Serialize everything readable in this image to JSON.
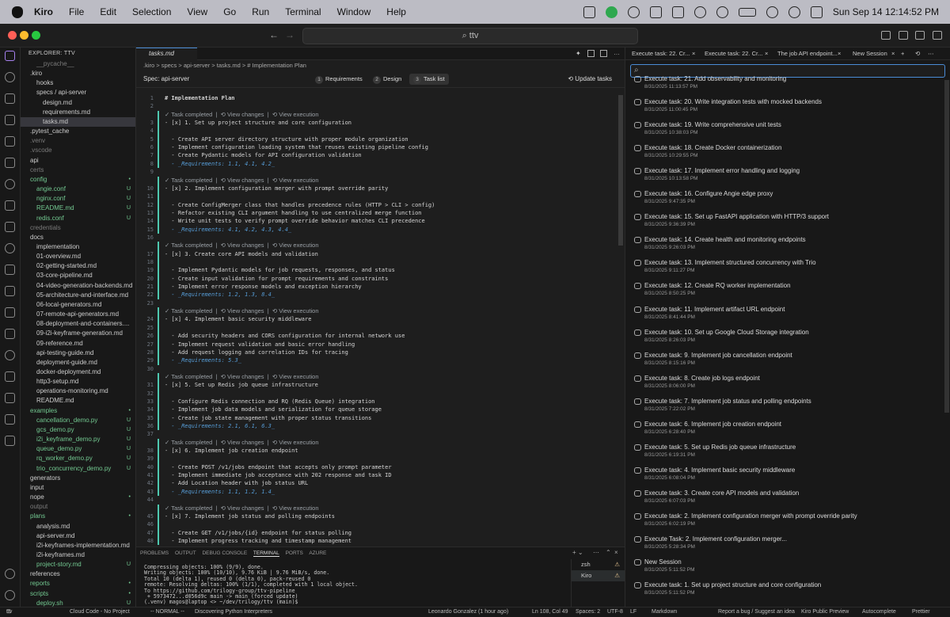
{
  "menubar": {
    "app": "Kiro",
    "items": [
      "File",
      "Edit",
      "Selection",
      "View",
      "Go",
      "Run",
      "Terminal",
      "Window",
      "Help"
    ],
    "clock": "Sun Sep 14  12:14:52 PM"
  },
  "titlebar": {
    "search": "ttv"
  },
  "explorer": {
    "title": "EXPLORER: TTV",
    "rows": [
      {
        "label": "__pycache__",
        "indent": 1,
        "cls": "dim",
        "status": ""
      },
      {
        "label": ".kiro",
        "indent": 0,
        "cls": "",
        "status": ""
      },
      {
        "label": "hooks",
        "indent": 1,
        "cls": "",
        "status": ""
      },
      {
        "label": "specs / api-server",
        "indent": 1,
        "cls": "",
        "status": ""
      },
      {
        "label": "design.md",
        "indent": 2,
        "cls": "",
        "status": ""
      },
      {
        "label": "requirements.md",
        "indent": 2,
        "cls": "",
        "status": ""
      },
      {
        "label": "tasks.md",
        "indent": 2,
        "cls": "sel",
        "status": ""
      },
      {
        "label": ".pytest_cache",
        "indent": 0,
        "cls": "",
        "status": ""
      },
      {
        "label": ".venv",
        "indent": 0,
        "cls": "dim",
        "status": ""
      },
      {
        "label": ".vscode",
        "indent": 0,
        "cls": "dim",
        "status": ""
      },
      {
        "label": "api",
        "indent": 0,
        "cls": "",
        "status": ""
      },
      {
        "label": "certs",
        "indent": 0,
        "cls": "dim",
        "status": ""
      },
      {
        "label": "config",
        "indent": 0,
        "cls": "unt",
        "status": "•"
      },
      {
        "label": "angie.conf",
        "indent": 1,
        "cls": "unt",
        "status": "U"
      },
      {
        "label": "nginx.conf",
        "indent": 1,
        "cls": "unt",
        "status": "U"
      },
      {
        "label": "README.md",
        "indent": 1,
        "cls": "unt",
        "status": "U"
      },
      {
        "label": "redis.conf",
        "indent": 1,
        "cls": "unt",
        "status": "U"
      },
      {
        "label": "credentials",
        "indent": 0,
        "cls": "dim",
        "status": ""
      },
      {
        "label": "docs",
        "indent": 0,
        "cls": "",
        "status": ""
      },
      {
        "label": "implementation",
        "indent": 1,
        "cls": "",
        "status": ""
      },
      {
        "label": "01-overview.md",
        "indent": 1,
        "cls": "",
        "status": ""
      },
      {
        "label": "02-getting-started.md",
        "indent": 1,
        "cls": "",
        "status": ""
      },
      {
        "label": "03-core-pipeline.md",
        "indent": 1,
        "cls": "",
        "status": ""
      },
      {
        "label": "04-video-generation-backends.md",
        "indent": 1,
        "cls": "",
        "status": ""
      },
      {
        "label": "05-architecture-and-interface.md",
        "indent": 1,
        "cls": "",
        "status": ""
      },
      {
        "label": "06-local-generators.md",
        "indent": 1,
        "cls": "",
        "status": ""
      },
      {
        "label": "07-remote-api-generators.md",
        "indent": 1,
        "cls": "",
        "status": ""
      },
      {
        "label": "08-deployment-and-containers....",
        "indent": 1,
        "cls": "",
        "status": ""
      },
      {
        "label": "09-i2i-keyframe-generation.md",
        "indent": 1,
        "cls": "",
        "status": ""
      },
      {
        "label": "09-reference.md",
        "indent": 1,
        "cls": "",
        "status": ""
      },
      {
        "label": "api-testing-guide.md",
        "indent": 1,
        "cls": "",
        "status": ""
      },
      {
        "label": "deployment-guide.md",
        "indent": 1,
        "cls": "",
        "status": ""
      },
      {
        "label": "docker-deployment.md",
        "indent": 1,
        "cls": "",
        "status": ""
      },
      {
        "label": "http3-setup.md",
        "indent": 1,
        "cls": "",
        "status": ""
      },
      {
        "label": "operations-monitoring.md",
        "indent": 1,
        "cls": "",
        "status": ""
      },
      {
        "label": "README.md",
        "indent": 1,
        "cls": "",
        "status": ""
      },
      {
        "label": "examples",
        "indent": 0,
        "cls": "unt",
        "status": "•"
      },
      {
        "label": "cancellation_demo.py",
        "indent": 1,
        "cls": "unt",
        "status": "U"
      },
      {
        "label": "gcs_demo.py",
        "indent": 1,
        "cls": "unt",
        "status": "U"
      },
      {
        "label": "i2i_keyframe_demo.py",
        "indent": 1,
        "cls": "unt",
        "status": "U"
      },
      {
        "label": "queue_demo.py",
        "indent": 1,
        "cls": "unt",
        "status": "U"
      },
      {
        "label": "rq_worker_demo.py",
        "indent": 1,
        "cls": "unt",
        "status": "U"
      },
      {
        "label": "trio_concurrency_demo.py",
        "indent": 1,
        "cls": "unt",
        "status": "U"
      },
      {
        "label": "generators",
        "indent": 0,
        "cls": "",
        "status": ""
      },
      {
        "label": "input",
        "indent": 0,
        "cls": "",
        "status": ""
      },
      {
        "label": "nope",
        "indent": 0,
        "cls": "",
        "status": "•"
      },
      {
        "label": "output",
        "indent": 0,
        "cls": "dim",
        "status": ""
      },
      {
        "label": "plans",
        "indent": 0,
        "cls": "unt",
        "status": "•"
      },
      {
        "label": "analysis.md",
        "indent": 1,
        "cls": "",
        "status": ""
      },
      {
        "label": "api-server.md",
        "indent": 1,
        "cls": "",
        "status": ""
      },
      {
        "label": "i2i-keyframes-implementation.md",
        "indent": 1,
        "cls": "",
        "status": ""
      },
      {
        "label": "i2i-keyframes.md",
        "indent": 1,
        "cls": "",
        "status": ""
      },
      {
        "label": "project-story.md",
        "indent": 1,
        "cls": "unt",
        "status": "U"
      },
      {
        "label": "references",
        "indent": 0,
        "cls": "",
        "status": ""
      },
      {
        "label": "reports",
        "indent": 0,
        "cls": "unt",
        "status": "•"
      },
      {
        "label": "scripts",
        "indent": 0,
        "cls": "unt",
        "status": "•"
      },
      {
        "label": "deploy.sh",
        "indent": 1,
        "cls": "unt",
        "status": "U"
      }
    ]
  },
  "editor": {
    "tab": "tasks.md",
    "breadcrumb": ".kiro  >  specs  >  api-server  >  tasks.md  >  # Implementation Plan",
    "spec_label": "Spec: api-server",
    "steps": [
      {
        "num": "1",
        "label": "Requirements"
      },
      {
        "num": "2",
        "label": "Design"
      },
      {
        "num": "3",
        "label": "Task list"
      }
    ],
    "update_tasks": "Update tasks",
    "lens_text": "✓ Task completed  |  ⟲ View changes  |  ⟲ View execution",
    "lines": [
      {
        "n": "1",
        "t": "# Implementation Plan",
        "k": "hd"
      },
      {
        "n": "2",
        "t": "",
        "k": "tx"
      },
      {
        "n": "",
        "t": "LENS",
        "k": "lens"
      },
      {
        "n": "3",
        "t": "- [x] 1. Set up project structure and core configuration",
        "k": "tx"
      },
      {
        "n": "4",
        "t": "",
        "k": "tx"
      },
      {
        "n": "5",
        "t": "  - Create API server directory structure with proper module organization",
        "k": "tx"
      },
      {
        "n": "6",
        "t": "  - Implement configuration loading system that reuses existing pipeline config",
        "k": "tx"
      },
      {
        "n": "7",
        "t": "  - Create Pydantic models for API configuration validation",
        "k": "tx"
      },
      {
        "n": "8",
        "t": "  - _Requirements: 1.1, 4.1, 4.2_",
        "k": "em"
      },
      {
        "n": "9",
        "t": "",
        "k": "tx"
      },
      {
        "n": "",
        "t": "LENS",
        "k": "lens"
      },
      {
        "n": "10",
        "t": "- [x] 2. Implement configuration merger with prompt override parity",
        "k": "tx"
      },
      {
        "n": "11",
        "t": "",
        "k": "tx"
      },
      {
        "n": "12",
        "t": "  - Create ConfigMerger class that handles precedence rules (HTTP > CLI > config)",
        "k": "tx"
      },
      {
        "n": "13",
        "t": "  - Refactor existing CLI argument handling to use centralized merge function",
        "k": "tx"
      },
      {
        "n": "14",
        "t": "  - Write unit tests to verify prompt override behavior matches CLI precedence",
        "k": "tx"
      },
      {
        "n": "15",
        "t": "  - _Requirements: 4.1, 4.2, 4.3, 4.4_",
        "k": "em"
      },
      {
        "n": "16",
        "t": "",
        "k": "tx"
      },
      {
        "n": "",
        "t": "LENS",
        "k": "lens"
      },
      {
        "n": "17",
        "t": "- [x] 3. Create core API models and validation",
        "k": "tx"
      },
      {
        "n": "18",
        "t": "",
        "k": "tx"
      },
      {
        "n": "19",
        "t": "  - Implement Pydantic models for job requests, responses, and status",
        "k": "tx"
      },
      {
        "n": "20",
        "t": "  - Create input validation for prompt requirements and constraints",
        "k": "tx"
      },
      {
        "n": "21",
        "t": "  - Implement error response models and exception hierarchy",
        "k": "tx"
      },
      {
        "n": "22",
        "t": "  - _Requirements: 1.2, 1.3, 8.4_",
        "k": "em"
      },
      {
        "n": "23",
        "t": "",
        "k": "tx"
      },
      {
        "n": "",
        "t": "LENS",
        "k": "lens"
      },
      {
        "n": "24",
        "t": "- [x] 4. Implement basic security middleware",
        "k": "tx"
      },
      {
        "n": "25",
        "t": "",
        "k": "tx"
      },
      {
        "n": "26",
        "t": "  - Add security headers and CORS configuration for internal network use",
        "k": "tx"
      },
      {
        "n": "27",
        "t": "  - Implement request validation and basic error handling",
        "k": "tx"
      },
      {
        "n": "28",
        "t": "  - Add request logging and correlation IDs for tracing",
        "k": "tx"
      },
      {
        "n": "29",
        "t": "  - _Requirements: 5.3_",
        "k": "em"
      },
      {
        "n": "30",
        "t": "",
        "k": "tx"
      },
      {
        "n": "",
        "t": "LENS",
        "k": "lens"
      },
      {
        "n": "31",
        "t": "- [x] 5. Set up Redis job queue infrastructure",
        "k": "tx"
      },
      {
        "n": "32",
        "t": "",
        "k": "tx"
      },
      {
        "n": "33",
        "t": "  - Configure Redis connection and RQ (Redis Queue) integration",
        "k": "tx"
      },
      {
        "n": "34",
        "t": "  - Implement job data models and serialization for queue storage",
        "k": "tx"
      },
      {
        "n": "35",
        "t": "  - Create job state management with proper status transitions",
        "k": "tx"
      },
      {
        "n": "36",
        "t": "  - _Requirements: 2.1, 6.1, 6.3_",
        "k": "em"
      },
      {
        "n": "37",
        "t": "",
        "k": "tx"
      },
      {
        "n": "",
        "t": "LENS",
        "k": "lens"
      },
      {
        "n": "38",
        "t": "- [x] 6. Implement job creation endpoint",
        "k": "tx"
      },
      {
        "n": "39",
        "t": "",
        "k": "tx"
      },
      {
        "n": "40",
        "t": "  - Create POST /v1/jobs endpoint that accepts only prompt parameter",
        "k": "tx"
      },
      {
        "n": "41",
        "t": "  - Implement immediate job acceptance with 202 response and task ID",
        "k": "tx"
      },
      {
        "n": "42",
        "t": "  - Add Location header with job status URL",
        "k": "tx"
      },
      {
        "n": "43",
        "t": "  - _Requirements: 1.1, 1.2, 1.4_",
        "k": "em"
      },
      {
        "n": "44",
        "t": "",
        "k": "tx"
      },
      {
        "n": "",
        "t": "LENS",
        "k": "lens"
      },
      {
        "n": "45",
        "t": "- [x] 7. Implement job status and polling endpoints",
        "k": "tx"
      },
      {
        "n": "46",
        "t": "",
        "k": "tx"
      },
      {
        "n": "47",
        "t": "  - Create GET /v1/jobs/{id} endpoint for status polling",
        "k": "tx"
      },
      {
        "n": "48",
        "t": "  - Implement progress tracking and timestamp management",
        "k": "tx"
      }
    ]
  },
  "panel": {
    "tabs": [
      "PROBLEMS",
      "OUTPUT",
      "DEBUG CONSOLE",
      "TERMINAL",
      "PORTS",
      "AZURE"
    ],
    "active_tab": "TERMINAL",
    "terminal": "Compressing objects: 100% (9/9), done.\nWriting objects: 100% (10/10), 9.76 KiB | 9.76 MiB/s, done.\nTotal 10 (delta 1), reused 0 (delta 0), pack-reused 0\nremote: Resolving deltas: 100% (1/1), completed with 1 local object.\nTo https://github.com/trilogy-group/ttv-pipeline\n + 5973472...d056d9c main -> main (forced update)\n(.venv) magos@laptop <> ~/dev/trilogy/ttv (main)$ ",
    "terminals": [
      {
        "label": "zsh"
      },
      {
        "label": "Kiro"
      }
    ]
  },
  "right": {
    "tabs": [
      "Execute task: 22. Cr...",
      "Execute task: 22. Cr...",
      "The job API endpoint...",
      "New Session"
    ],
    "sessions": [
      {
        "t": "Execute task: 21. Add observability and monitoring",
        "d": "8/31/2025 11:13:57 PM"
      },
      {
        "t": "Execute task: 20. Write integration tests with mocked backends",
        "d": "8/31/2025 11:00:45 PM"
      },
      {
        "t": "Execute task: 19. Write comprehensive unit tests",
        "d": "8/31/2025 10:38:03 PM"
      },
      {
        "t": "Execute task: 18. Create Docker containerization",
        "d": "8/31/2025 10:29:55 PM"
      },
      {
        "t": "Execute task: 17. Implement error handling and logging",
        "d": "8/31/2025 10:13:58 PM"
      },
      {
        "t": "Execute task: 16. Configure Angie edge proxy",
        "d": "8/31/2025 9:47:35 PM"
      },
      {
        "t": "Execute task: 15. Set up FastAPI application with HTTP/3 support",
        "d": "8/31/2025 9:36:39 PM"
      },
      {
        "t": "Execute task: 14. Create health and monitoring endpoints",
        "d": "8/31/2025 9:26:03 PM"
      },
      {
        "t": "Execute task: 13. Implement structured concurrency with Trio",
        "d": "8/31/2025 9:11:27 PM"
      },
      {
        "t": "Execute task: 12. Create RQ worker implementation",
        "d": "8/31/2025 8:50:25 PM"
      },
      {
        "t": "Execute task: 11. Implement artifact URL endpoint",
        "d": "8/31/2025 8:41:44 PM"
      },
      {
        "t": "Execute task: 10. Set up Google Cloud Storage integration",
        "d": "8/31/2025 8:26:03 PM"
      },
      {
        "t": "Execute task: 9. Implement job cancellation endpoint",
        "d": "8/31/2025 8:15:16 PM"
      },
      {
        "t": "Execute task: 8. Create job logs endpoint",
        "d": "8/31/2025 8:06:00 PM"
      },
      {
        "t": "Execute task: 7. Implement job status and polling endpoints",
        "d": "8/31/2025 7:22:02 PM"
      },
      {
        "t": "Execute task: 6. Implement job creation endpoint",
        "d": "8/31/2025 6:28:40 PM"
      },
      {
        "t": "Execute task: 5. Set up Redis job queue infrastructure",
        "d": "8/31/2025 6:19:31 PM"
      },
      {
        "t": "Execute task: 4. Implement basic security middleware",
        "d": "8/31/2025 6:08:04 PM"
      },
      {
        "t": "Execute task: 3. Create core API models and validation",
        "d": "8/31/2025 6:07:03 PM"
      },
      {
        "t": "Execute task: 2. Implement configuration merger with prompt override parity",
        "d": "8/31/2025 6:02:19 PM"
      },
      {
        "t": "Execute Task: 2. Implement configuration merger...",
        "d": "8/31/2025 5:28:34 PM"
      },
      {
        "t": "New Session",
        "d": "8/31/2025 5:11:52 PM"
      },
      {
        "t": "Execute task: 1. Set up project structure and core configuration",
        "d": "8/31/2025 5:11:52 PM"
      }
    ]
  },
  "status": {
    "branch": "ttv",
    "build": "Cloud Code - No Project",
    "mode": "-- NORMAL --",
    "discover": "Discovering Python Interpreters",
    "blame": "Leonardo Gonzalez (1 hour ago)",
    "position": "Ln 108, Col 49",
    "spaces": "Spaces: 2",
    "encoding": "UTF-8",
    "eol": "LF",
    "lang": "Markdown",
    "report": "Report a bug / Suggest an idea",
    "preview": "Kiro Public Preview",
    "autocomplete": "Autocomplete",
    "prettier": "Prettier"
  },
  "colors": {
    "accent": "#4a8cd6",
    "completed": "#4ec9b0",
    "untracked": "#73c991"
  }
}
